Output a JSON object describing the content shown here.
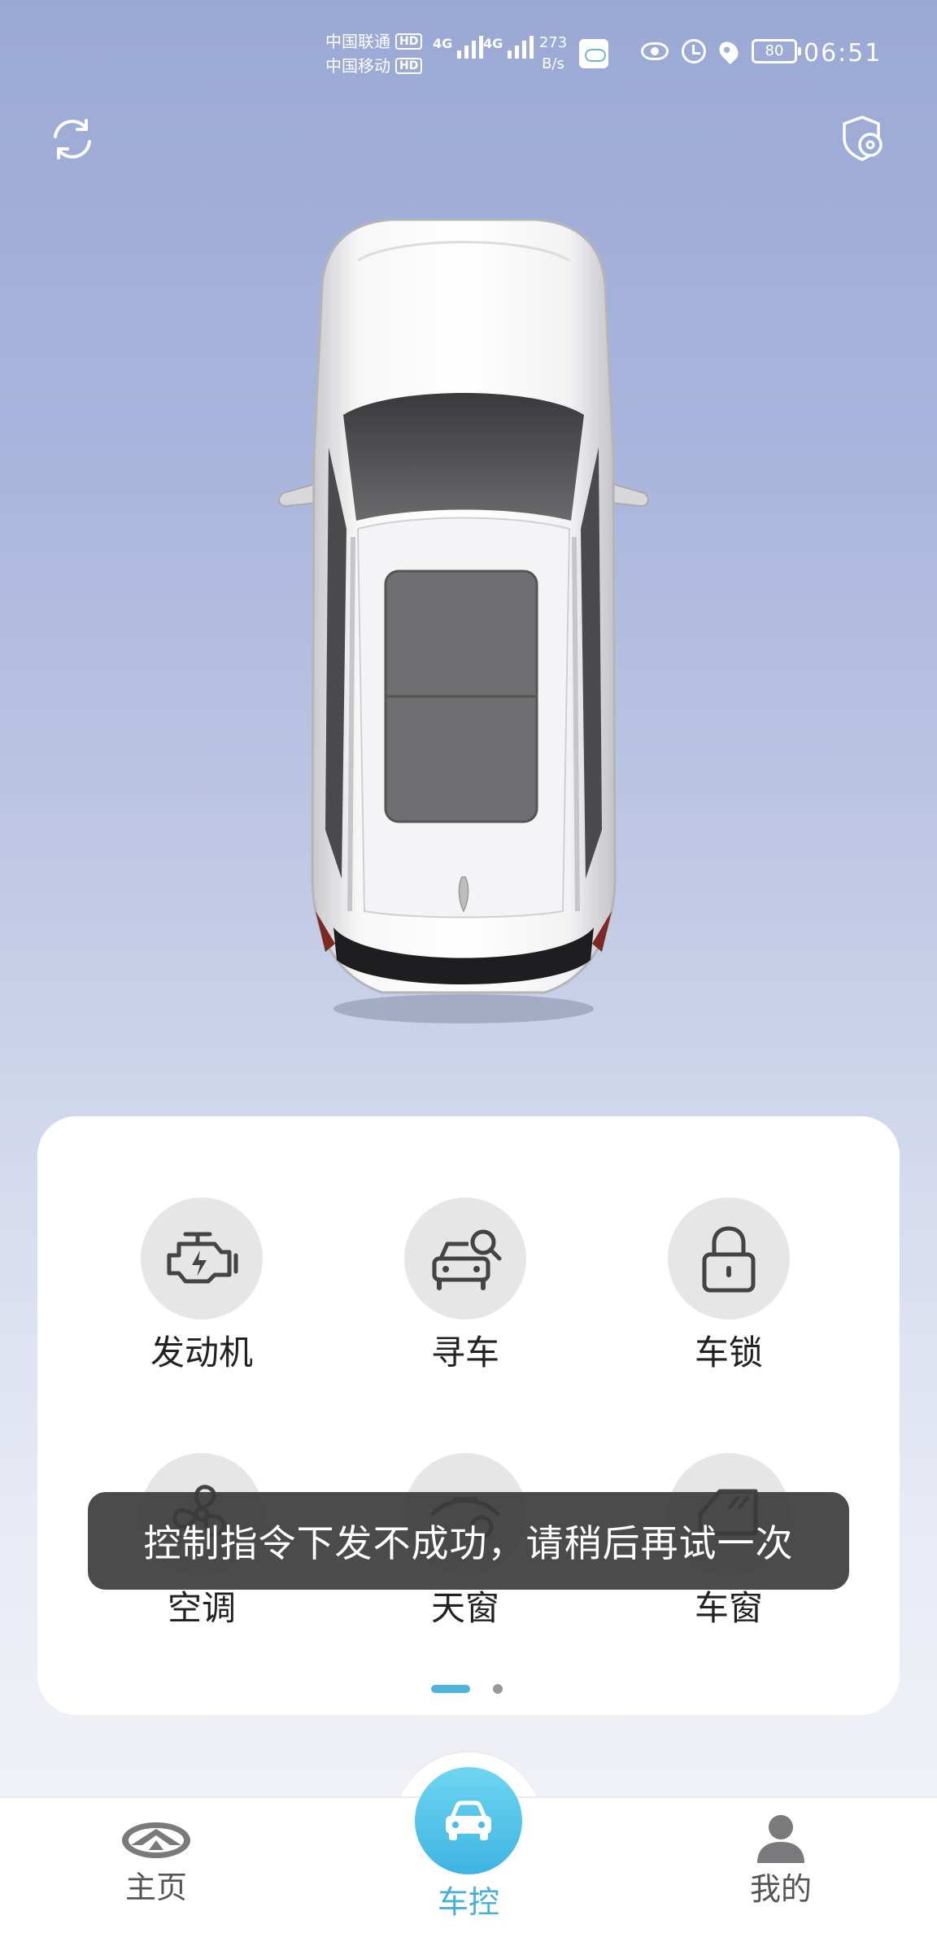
{
  "status_bar": {
    "carrier_1": "中国联通",
    "carrier_2": "中国移动",
    "hd": "HD",
    "network_1": "4G",
    "network_2": "4G",
    "speed_value": "273",
    "speed_unit": "B/s",
    "battery": "80",
    "time": "06:51",
    "icons": [
      "cloud-icon",
      "eye-icon",
      "alarm-icon",
      "location-pin-icon",
      "battery-icon"
    ]
  },
  "header": {
    "left_icon": "refresh-icon",
    "right_icon": "shield-settings-icon"
  },
  "controls": {
    "items": [
      {
        "label": "发动机",
        "icon": "engine-icon"
      },
      {
        "label": "寻车",
        "icon": "find-car-icon"
      },
      {
        "label": "车锁",
        "icon": "lock-icon"
      },
      {
        "label": "空调",
        "icon": "fan-icon"
      },
      {
        "label": "天窗",
        "icon": "sunroof-icon"
      },
      {
        "label": "车窗",
        "icon": "window-icon"
      }
    ],
    "page_index": 1,
    "page_count": 2
  },
  "toast": {
    "message": "控制指令下发不成功，请稍后再试一次"
  },
  "bottom_nav": {
    "items": [
      {
        "label": "主页",
        "icon": "brand-logo-icon",
        "active": false
      },
      {
        "label": "车控",
        "icon": "car-icon",
        "active": true
      },
      {
        "label": "我的",
        "icon": "user-icon",
        "active": false
      }
    ]
  },
  "colors": {
    "accent": "#48b0d8",
    "toast_bg": "#3c3c3c",
    "card_bg": "#ffffff",
    "icon_circle": "#e6e6e6"
  }
}
